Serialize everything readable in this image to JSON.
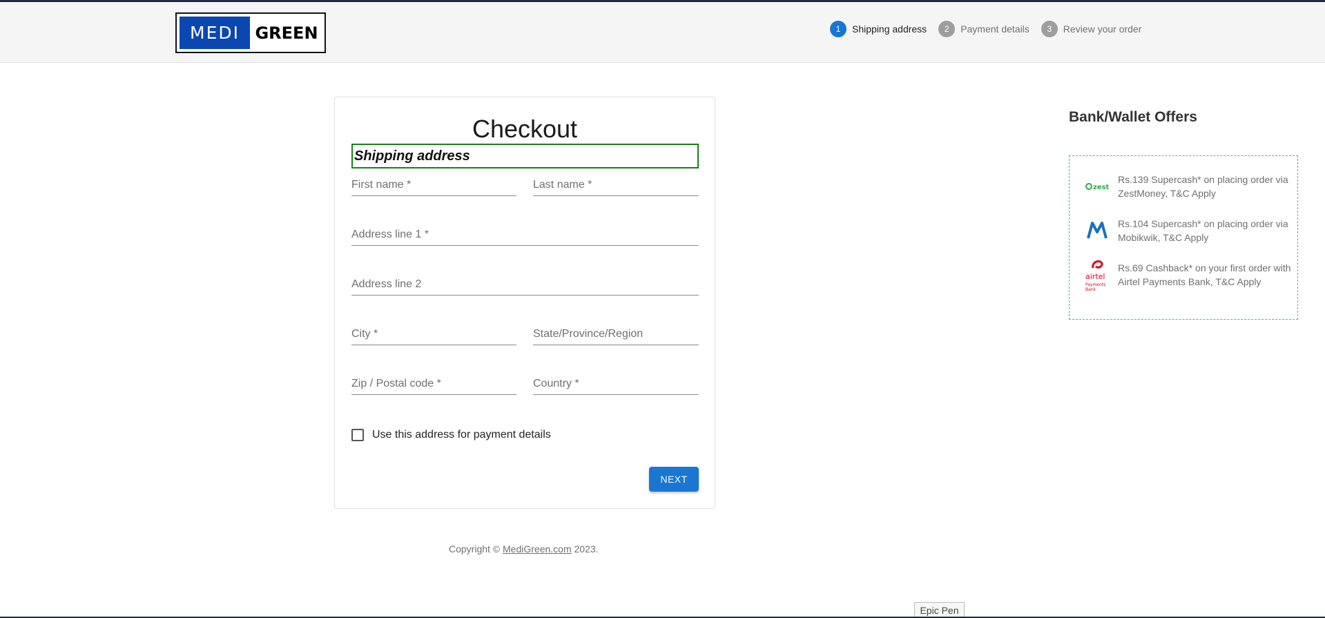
{
  "brand": {
    "logo_left": "MEDI",
    "logo_right": "GREEN",
    "color_primary": "#0a47b0"
  },
  "stepper": {
    "steps": [
      {
        "num": "1",
        "label": "Shipping address",
        "active": true
      },
      {
        "num": "2",
        "label": "Payment details",
        "active": false
      },
      {
        "num": "3",
        "label": "Review your order",
        "active": false
      }
    ]
  },
  "checkout": {
    "title": "Checkout",
    "section": "Shipping address",
    "fields": {
      "first_name": "First name *",
      "last_name": "Last name *",
      "address1": "Address line 1 *",
      "address2": "Address line 2",
      "city": "City *",
      "state": "State/Province/Region",
      "zip": "Zip / Postal code *",
      "country": "Country *"
    },
    "checkbox_label": "Use this address for payment details",
    "next_label": "NEXT"
  },
  "footer": {
    "prefix": "Copyright © ",
    "link": "MediGreen.com",
    "suffix": " 2023."
  },
  "offers": {
    "title": "Bank/Wallet Offers",
    "items": [
      {
        "icon": "zest-icon",
        "text": "Rs.139 Supercash* on placing order via ZestMoney, T&C Apply"
      },
      {
        "icon": "mobikwik-icon",
        "text": "Rs.104 Supercash* on placing order via Mobikwik, T&C Apply"
      },
      {
        "icon": "airtel-icon",
        "text": "Rs.69 Cashback* on your first order with Airtel Payments Bank, T&C Apply"
      }
    ]
  },
  "epic_pen": "Epic Pen"
}
